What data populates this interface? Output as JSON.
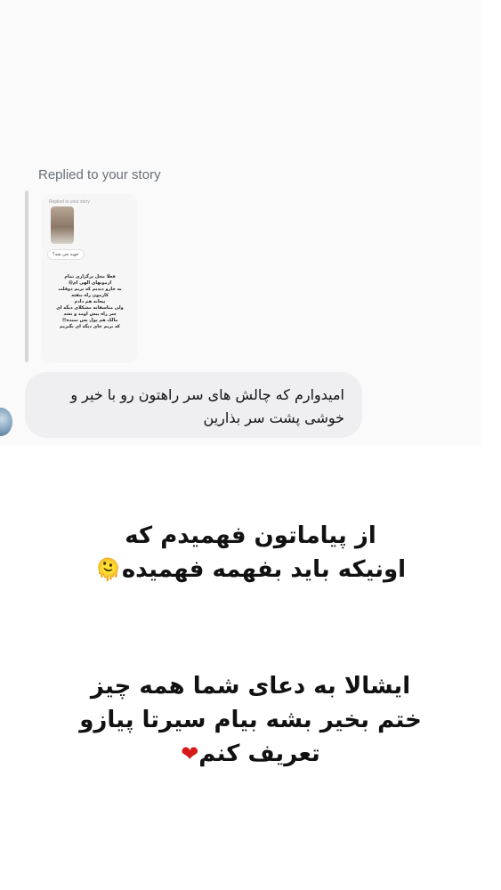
{
  "story": {
    "replied_label": "Replied to your story",
    "thumb": {
      "label": "Replied to your story",
      "bubble": "خونه چی شد؟",
      "text": "فعلا محل برگزاری تمام\nازمونهای الهی ام😆\nبه جارو دیدیم که بریم دوقلت\nکارمون راه بیفته\nبیعانه هم دادم\nولی متاسفانه مشکلای دیگه ای\nسر راه پیش اومد و نشد\nمالک هم پول پس نمیده😒\nکه بریم جای دیگه ای بگیریم"
    },
    "message": "امیدوارم که چالش های سر راهتون رو با خیر و\nخوشی پشت سر بذارین"
  },
  "overlay": {
    "line1": "از پیاماتون فهمیدم که\nاونیکه باید بفهمه فهمیده",
    "line1_emoji": "🫠",
    "line2": "ایشالا به دعای شما همه چیز\nختم بخیر بشه بیام سیرتا پیازو\nتعریف کنم",
    "line2_emoji": "❤"
  },
  "colors": {
    "bubble_bg": "#efeff1",
    "heart": "#d61a1a",
    "emoji_yellow": "#f2b01e"
  }
}
